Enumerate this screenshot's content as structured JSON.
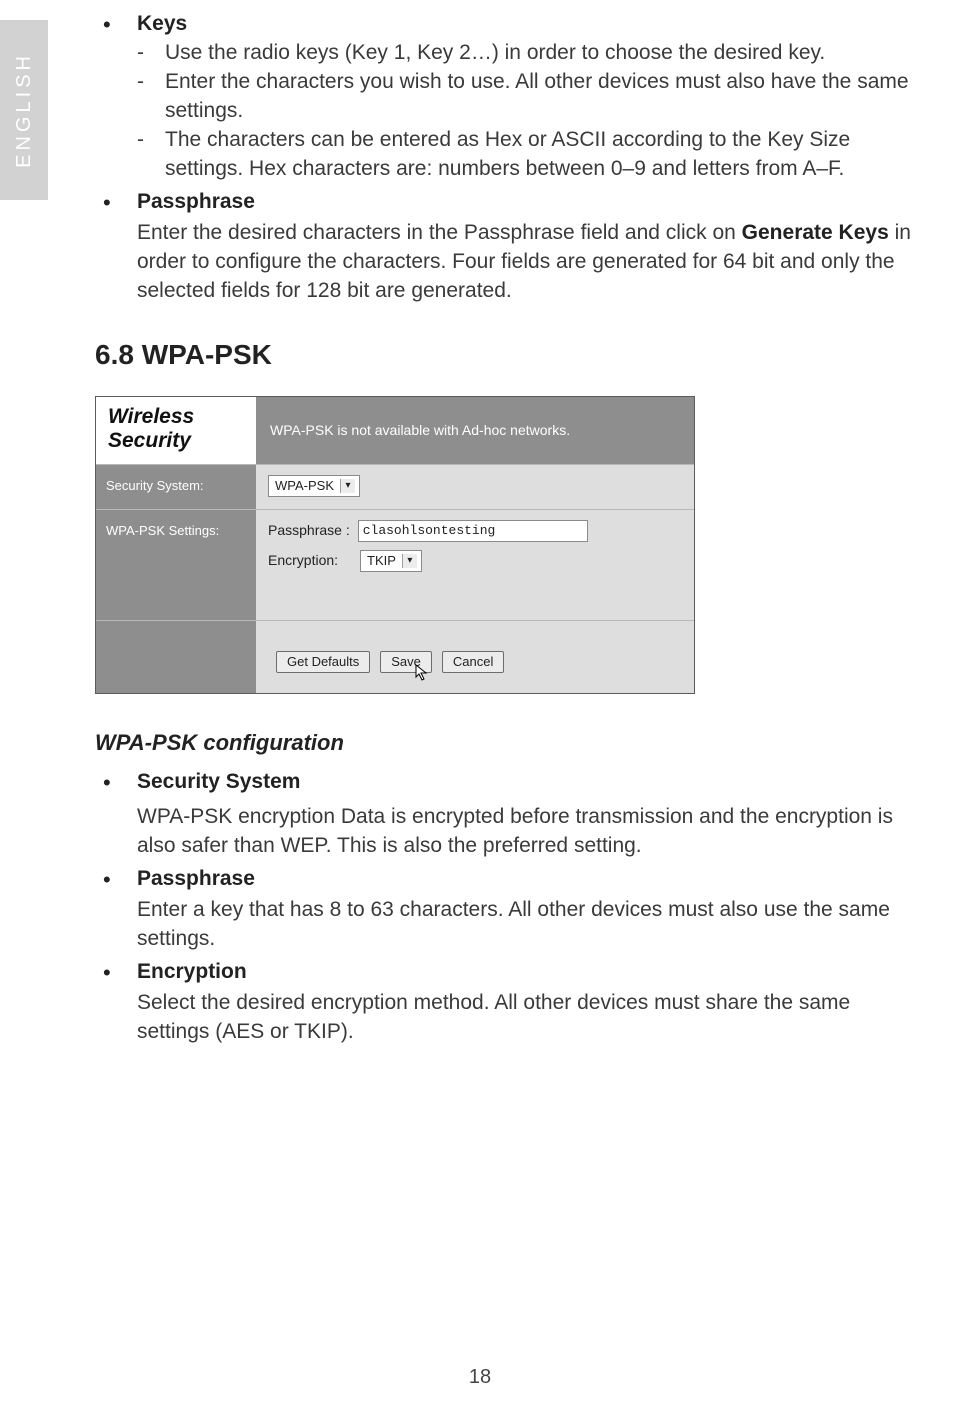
{
  "lang_tab": "ENGLISH",
  "keys_section": {
    "title": "Keys",
    "bullets": [
      "Use the radio keys (Key 1, Key 2…) in order to choose the desired key.",
      "Enter the characters you wish to use. All other devices must also have the same settings.",
      "The characters can be entered as Hex or ASCII according to the Key Size settings. Hex characters are: numbers between 0–9 and letters from A–F."
    ]
  },
  "passphrase_top": {
    "title": "Passphrase",
    "text_pre": "Enter the desired characters in the Passphrase field and click on ",
    "bold": "Generate Keys",
    "text_post": " in order to configure the characters. Four fields are generated for 64 bit and only the selected fields for 128 bit are generated."
  },
  "section_heading": "6.8 WPA-PSK",
  "screenshot": {
    "panel_title_line1": "Wireless",
    "panel_title_line2": "Security",
    "note": "WPA-PSK is not available with Ad-hoc networks.",
    "row1_label": "Security System:",
    "row1_select": "WPA-PSK",
    "row2_label": "WPA-PSK Settings:",
    "passphrase_label": "Passphrase :",
    "passphrase_value": "clasohlsontesting",
    "encryption_label": "Encryption:",
    "encryption_value": "TKIP",
    "btn_defaults": "Get Defaults",
    "btn_save": "Save",
    "btn_cancel": "Cancel"
  },
  "config_heading": "WPA-PSK configuration",
  "config": {
    "sec_sys_title": "Security System",
    "sec_sys_text": "WPA-PSK encryption Data is encrypted before transmission and the encryption is also safer than WEP. This is also the preferred setting.",
    "pass_title": "Passphrase",
    "pass_text": "Enter a key that has 8 to 63 characters. All other devices must also use the same settings.",
    "enc_title": "Encryption",
    "enc_text": "Select the desired encryption method. All other devices must share the same settings (AES or TKIP)."
  },
  "page_number": "18"
}
